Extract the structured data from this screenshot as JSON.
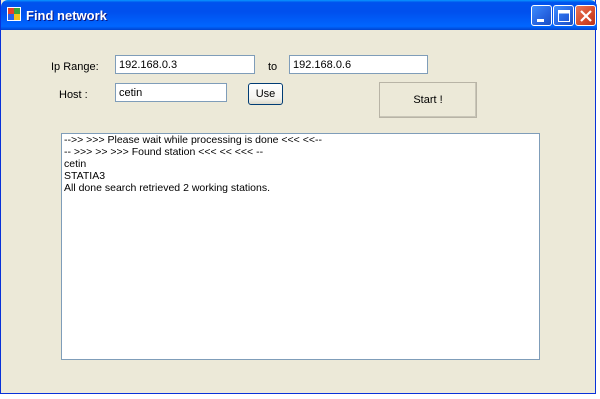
{
  "window": {
    "title": "Find network",
    "minimize_icon": "minimize-icon",
    "maximize_icon": "maximize-icon",
    "close_icon": "close-icon"
  },
  "form": {
    "ip_range_label": "Ip Range:",
    "ip_from_value": "192.168.0.3",
    "to_label": "to",
    "ip_to_value": "192.168.0.6",
    "host_label": "Host :",
    "host_value": "cetin",
    "use_button": "Use",
    "start_button": "Start !"
  },
  "output": {
    "lines": [
      "-->> >>> Please wait while processing is done <<< <<--",
      "-- >>> >> >>> Found station <<< << <<< --",
      "cetin",
      "STATIA3",
      "All done search retrieved 2 working stations."
    ]
  },
  "colors": {
    "titlebar": "#0053ee",
    "window_bg": "#ece9d8",
    "field_border": "#7f9db9"
  }
}
